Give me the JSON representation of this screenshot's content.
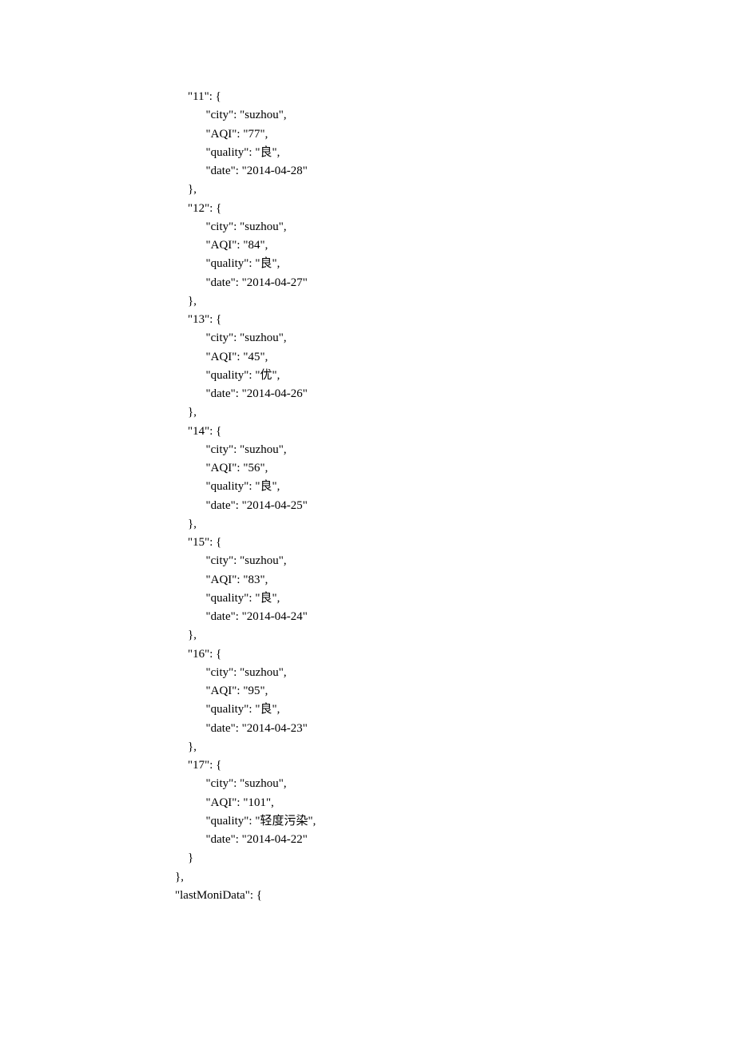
{
  "code_text": "\"11\": {\n      \"city\": \"suzhou\",\n      \"AQI\": \"77\",\n      \"quality\": \"良\",\n      \"date\": \"2014-04-28\"\n},\n\"12\": {\n      \"city\": \"suzhou\",\n      \"AQI\": \"84\",\n      \"quality\": \"良\",\n      \"date\": \"2014-04-27\"\n},\n\"13\": {\n      \"city\": \"suzhou\",\n      \"AQI\": \"45\",\n      \"quality\": \"优\",\n      \"date\": \"2014-04-26\"\n},\n\"14\": {\n      \"city\": \"suzhou\",\n      \"AQI\": \"56\",\n      \"quality\": \"良\",\n      \"date\": \"2014-04-25\"\n},\n\"15\": {\n      \"city\": \"suzhou\",\n      \"AQI\": \"83\",\n      \"quality\": \"良\",\n      \"date\": \"2014-04-24\"\n},\n\"16\": {\n      \"city\": \"suzhou\",\n      \"AQI\": \"95\",\n      \"quality\": \"良\",\n      \"date\": \"2014-04-23\"\n},\n\"17\": {\n      \"city\": \"suzhou\",\n      \"AQI\": \"101\",\n      \"quality\": \"轻度污染\",\n      \"date\": \"2014-04-22\"\n}",
  "closing_lines": "        },\n        \"lastMoniData\": {"
}
